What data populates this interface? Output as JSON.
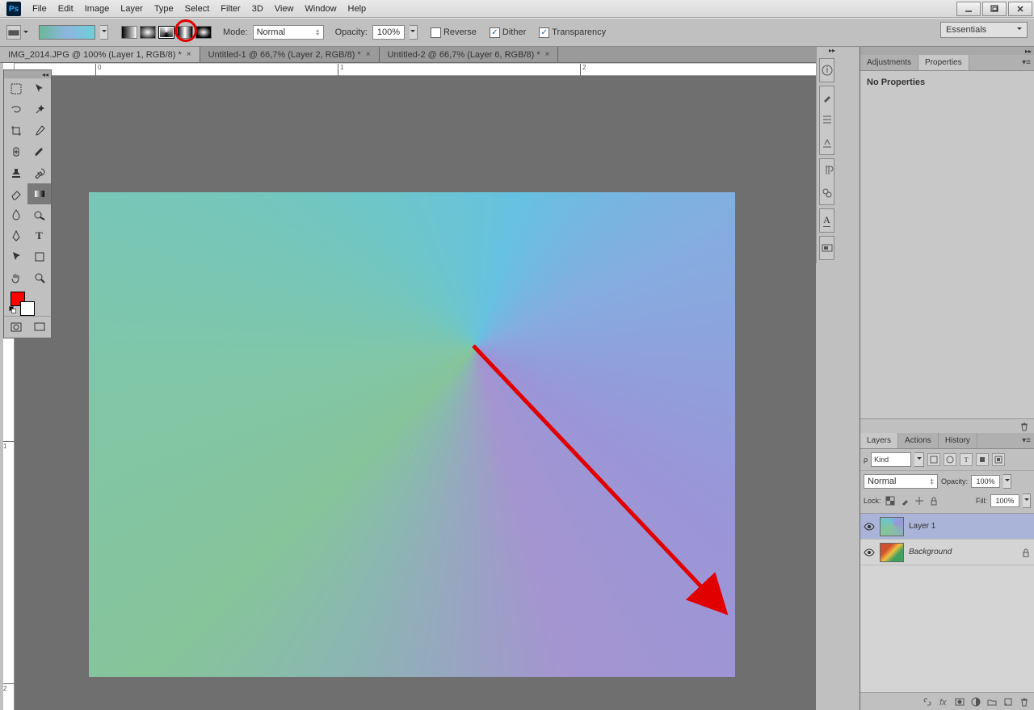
{
  "menubar": [
    "File",
    "Edit",
    "Image",
    "Layer",
    "Type",
    "Select",
    "Filter",
    "3D",
    "View",
    "Window",
    "Help"
  ],
  "options": {
    "mode_label": "Mode:",
    "mode_value": "Normal",
    "opacity_label": "Opacity:",
    "opacity_value": "100%",
    "reverse": "Reverse",
    "dither": "Dither",
    "transparency": "Transparency"
  },
  "workspace": "Essentials",
  "tabs": [
    "IMG_2014.JPG @ 100% (Layer 1, RGB/8) *",
    "Untitled-1 @ 66,7% (Layer 2, RGB/8) *",
    "Untitled-2 @ 66,7% (Layer 6, RGB/8) *"
  ],
  "ruler_h": [
    {
      "pos": 100,
      "label": "0"
    },
    {
      "pos": 400,
      "label": "1"
    },
    {
      "pos": 700,
      "label": "2"
    }
  ],
  "ruler_v": [
    {
      "pos": 452,
      "label": "1"
    },
    {
      "pos": 752,
      "label": "2"
    }
  ],
  "props": {
    "tab_adjust": "Adjustments",
    "tab_props": "Properties",
    "no_props": "No Properties"
  },
  "layers_panel": {
    "tabs": [
      "Layers",
      "Actions",
      "History"
    ],
    "kind": "Kind",
    "opacity_label": "Opacity:",
    "opacity_value": "100%",
    "fill_label": "Fill:",
    "fill_value": "100%",
    "lock_label": "Lock:",
    "blend": "Normal",
    "layers": [
      {
        "name": "Layer 1",
        "italic": false,
        "locked": false,
        "thumb": "grad",
        "selected": true
      },
      {
        "name": "Background",
        "italic": true,
        "locked": true,
        "thumb": "img",
        "selected": false
      }
    ]
  },
  "colors": {
    "fg": "#ff0000",
    "bg": "#ffffff"
  }
}
